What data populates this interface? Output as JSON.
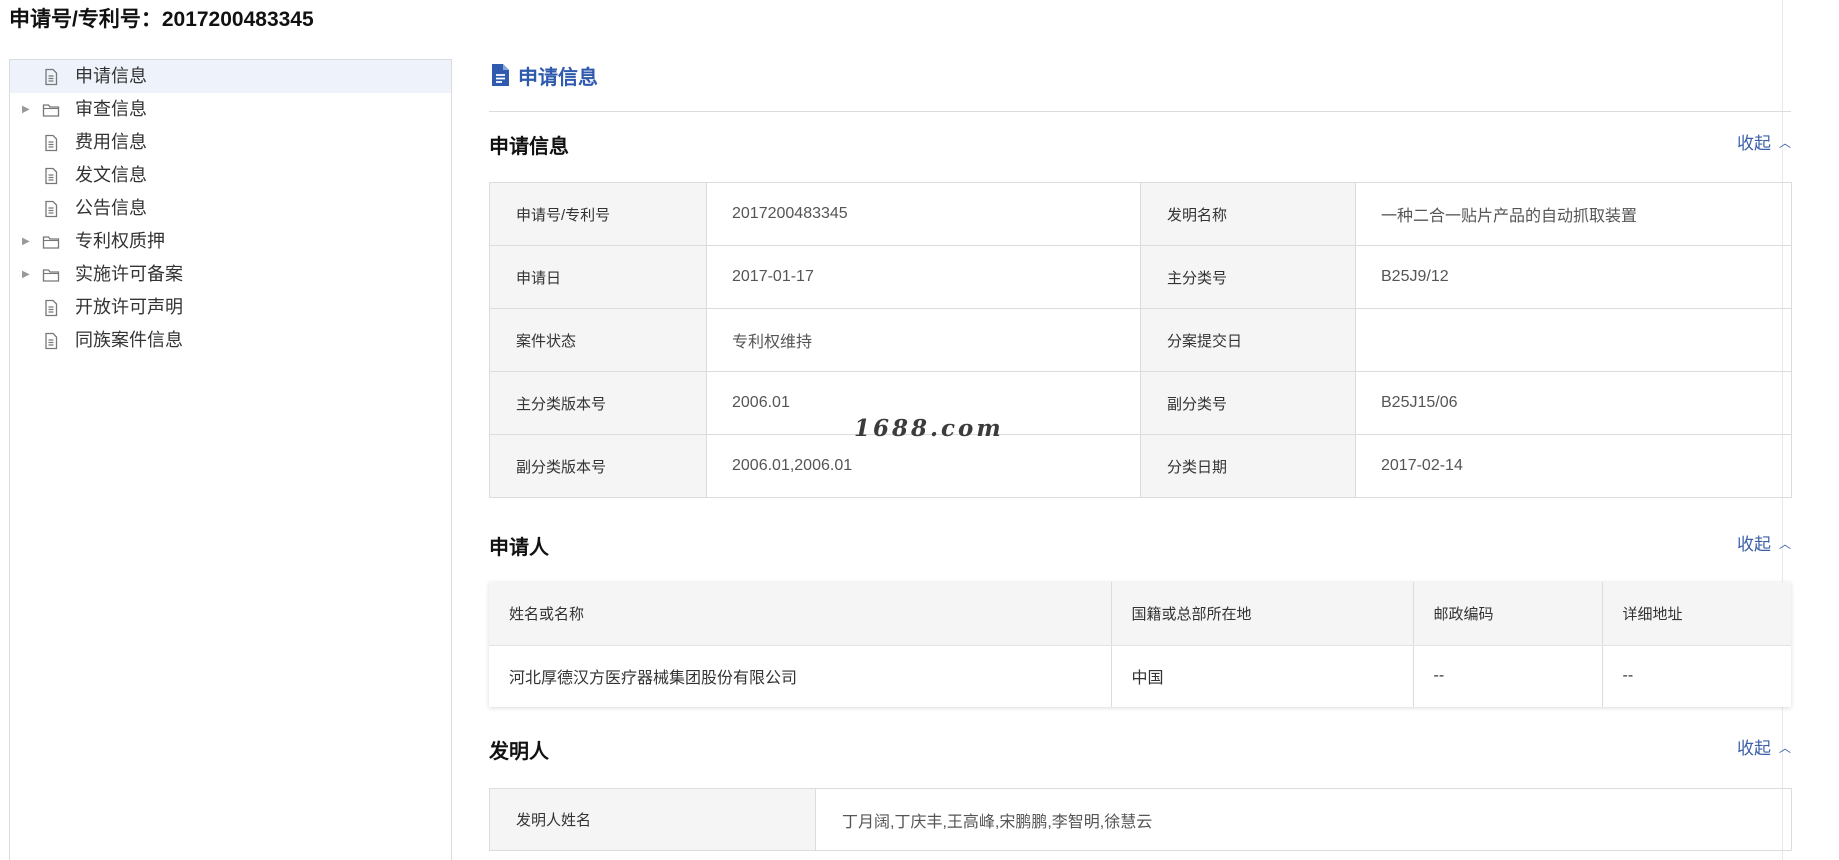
{
  "page_title": "申请号/专利号：2017200483345",
  "sidebar": {
    "items": [
      {
        "label": "申请信息",
        "icon": "document-icon",
        "expandable": false,
        "active": true
      },
      {
        "label": "审查信息",
        "icon": "folder-icon",
        "expandable": true,
        "active": false
      },
      {
        "label": "费用信息",
        "icon": "document-icon",
        "expandable": false,
        "active": false
      },
      {
        "label": "发文信息",
        "icon": "document-icon",
        "expandable": false,
        "active": false
      },
      {
        "label": "公告信息",
        "icon": "document-icon",
        "expandable": false,
        "active": false
      },
      {
        "label": "专利权质押",
        "icon": "folder-icon",
        "expandable": true,
        "active": false
      },
      {
        "label": "实施许可备案",
        "icon": "folder-icon",
        "expandable": true,
        "active": false
      },
      {
        "label": "开放许可声明",
        "icon": "document-icon",
        "expandable": false,
        "active": false
      },
      {
        "label": "同族案件信息",
        "icon": "document-icon",
        "expandable": false,
        "active": false
      }
    ]
  },
  "main": {
    "header_title": "申请信息",
    "header_icon": "document-icon",
    "collapse_label": "收起",
    "sections": {
      "application_info": {
        "title": "申请信息",
        "rows": [
          {
            "l1": "申请号/专利号",
            "v1": "2017200483345",
            "l2": "发明名称",
            "v2": "一种二合一贴片产品的自动抓取装置"
          },
          {
            "l1": "申请日",
            "v1": "2017-01-17",
            "l2": "主分类号",
            "v2": "B25J9/12"
          },
          {
            "l1": "案件状态",
            "v1": "专利权维持",
            "l2": "分案提交日",
            "v2": ""
          },
          {
            "l1": "主分类版本号",
            "v1": "2006.01",
            "l2": "副分类号",
            "v2": "B25J15/06"
          },
          {
            "l1": "副分类版本号",
            "v1": "2006.01,2006.01",
            "l2": "分类日期",
            "v2": "2017-02-14"
          }
        ]
      },
      "applicant": {
        "title": "申请人",
        "headers": [
          "姓名或名称",
          "国籍或总部所在地",
          "邮政编码",
          "详细地址"
        ],
        "row": [
          "河北厚德汉方医疗器械集团股份有限公司",
          "中国",
          "--",
          "--"
        ]
      },
      "inventor": {
        "title": "发明人",
        "label": "发明人姓名",
        "value": "丁月阔,丁庆丰,王高峰,宋鹏鹏,李智明,徐慧云"
      }
    }
  },
  "watermark": "1688.com",
  "colors": {
    "accent": "#2f5aae",
    "link": "#3b5fa8",
    "label_bg": "#f5f5f5",
    "border": "#dcdcdc",
    "active_bg": "#eef3fb"
  }
}
